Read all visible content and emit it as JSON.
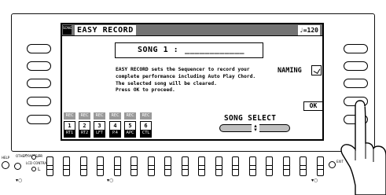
{
  "screen": {
    "header_icon_text": "SONG",
    "title": "EASY RECORD",
    "tempo": "♩=120"
  },
  "song": {
    "label": "SONG 1 :",
    "name": "____________"
  },
  "message": {
    "lines": [
      "EASY RECORD sets the Sequencer to record your",
      "complete performance including Auto Play Chord.",
      "The selected song will be cleared.",
      "Press OK to proceed."
    ]
  },
  "naming": {
    "label": "NAMING",
    "icon": "pencil-icon"
  },
  "ok": {
    "label": "OK"
  },
  "tracks": [
    {
      "rec": "REC",
      "num": "1",
      "name": "RT1"
    },
    {
      "rec": "REC",
      "num": "2",
      "name": "RT2"
    },
    {
      "rec": "REC",
      "num": "3",
      "name": "LFT"
    },
    {
      "rec": "REC",
      "num": "4",
      "name": "P.4"
    },
    {
      "rec": "REC",
      "num": "5",
      "name": "APC"
    },
    {
      "rec": "REC",
      "num": "6",
      "name": "CTL"
    }
  ],
  "song_select": {
    "label": "SONG SELECT",
    "arrows_icon": "up-down-arrows-icon"
  },
  "panel_labels": {
    "help": "HELP",
    "other_parts": "OTHER PARTS/TR",
    "lcd_contrast": "LCD CONTRAST",
    "exit": "EXIT"
  }
}
